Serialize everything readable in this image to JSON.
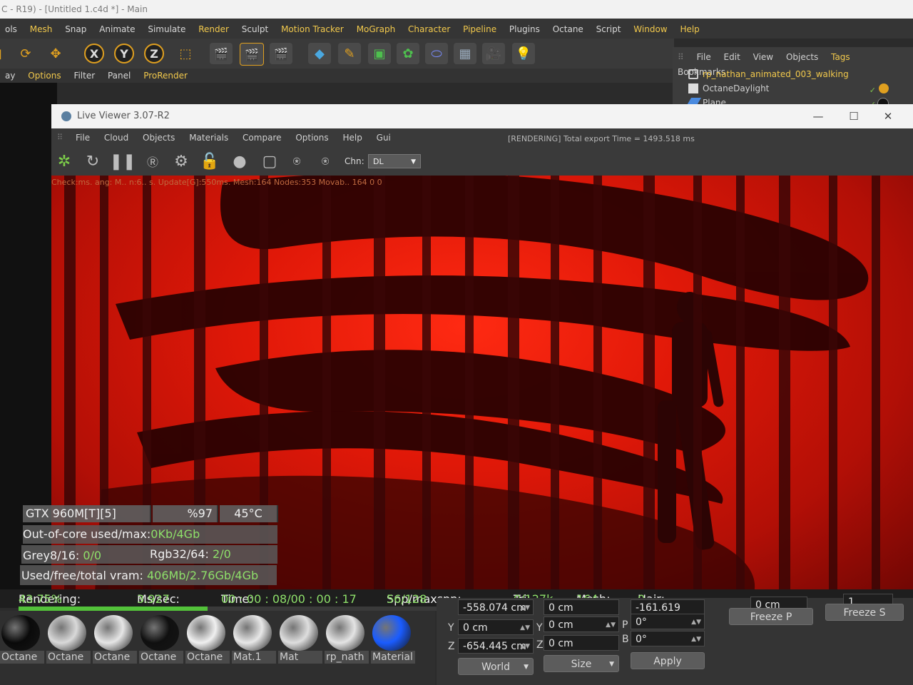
{
  "c4d": {
    "title": "C - R19) - [Untitled 1.c4d *] - Main",
    "menu": [
      {
        "label": "ols"
      },
      {
        "label": "Mesh"
      },
      {
        "label": "Snap"
      },
      {
        "label": "Animate"
      },
      {
        "label": "Simulate"
      },
      {
        "label": "Render"
      },
      {
        "label": "Sculpt"
      },
      {
        "label": "Motion Tracker"
      },
      {
        "label": "MoGraph"
      },
      {
        "label": "Character"
      },
      {
        "label": "Pipeline"
      },
      {
        "label": "Plugins"
      },
      {
        "label": "Octane"
      },
      {
        "label": "Script"
      },
      {
        "label": "Window"
      },
      {
        "label": "Help"
      }
    ],
    "axis_buttons": [
      "X",
      "Y",
      "Z"
    ],
    "viewport_menu": [
      "ay",
      "Options",
      "Filter",
      "Panel",
      "ProRender"
    ]
  },
  "object_manager": {
    "menu": [
      "File",
      "Edit",
      "View",
      "Objects",
      "Tags",
      "Bookmarks"
    ],
    "objects": [
      {
        "label": "rp_nathan_animated_003_walking",
        "color": "#f2c94c"
      },
      {
        "label": "OctaneDaylight",
        "color": "#d8d8d8"
      },
      {
        "label": "Plane",
        "color": "#d8d8d8"
      }
    ]
  },
  "live_viewer": {
    "title": "Live Viewer 3.07-R2",
    "window_buttons": {
      "minimize": "—",
      "maximize": "☐",
      "close": "✕"
    },
    "menu": [
      "File",
      "Cloud",
      "Objects",
      "Materials",
      "Compare",
      "Options",
      "Help",
      "Gui"
    ],
    "status": "[RENDERING] Total export Time = 1493.518 ms",
    "channel_label": "Chn:",
    "channel_value": "DL",
    "render_info": "Check:ms. ang: M.. n:6.. s. Update[G]:550ms. Mesh:164 Nodes:353 Movab.. 164 0 0"
  },
  "stats": {
    "gpu": "GTX 960M[T][5]",
    "gpu_load": "%97",
    "gpu_temp": "45°C",
    "out_of_core_label": "Out-of-core used/max:",
    "out_of_core_value": "0Kb/4Gb",
    "grey_label": "Grey8/16: ",
    "grey_value": "0/0",
    "rgb_label": "Rgb32/64: ",
    "rgb_value": "2/0",
    "vram_label": "Used/free/total vram: ",
    "vram_value": "406Mb/2.76Gb/4Gb"
  },
  "render_status": {
    "rendering_label": "Rendering: ",
    "rendering_value": "43.75%",
    "mssec_label": "Ms/sec: ",
    "mssec_value": "3.927",
    "time_label": "Time: ",
    "time_value": "00 : 00 : 08/00 : 00 : 17",
    "spp_label": "Spp/maxspp: ",
    "spp_value": "56/128",
    "tri_label": "Tri: ",
    "tri_value": "0/127k",
    "mesh_label": "Mesh: ",
    "mesh_value": "164",
    "hair_label": "Hair: ",
    "hair_value": "0",
    "progress": 0.4375
  },
  "materials": [
    {
      "name": "Octane",
      "color": "#0a0a0a"
    },
    {
      "name": "Octane",
      "color": "#d9d9d9"
    },
    {
      "name": "Octane",
      "color": "#e6e6e6"
    },
    {
      "name": "Octane",
      "color": "#101010"
    },
    {
      "name": "Octane",
      "color": "#f0f0f0"
    },
    {
      "name": "Mat.1",
      "color": "#e8e8e8"
    },
    {
      "name": "Mat",
      "color": "#dedede"
    },
    {
      "name": "rp_nath",
      "color": "#e4e4e4"
    },
    {
      "name": "Material",
      "color": "#1a5cff"
    }
  ],
  "coordinates": {
    "x_pos": "-558.074 cm",
    "x_size": "0 cm",
    "h_rot": "-161.619",
    "y_pos": "0 cm",
    "y_size": "0 cm",
    "p_rot": "0°",
    "z_pos": "-654.445 cm",
    "z_size": "0 cm",
    "b_rot": "0°",
    "pz_value": "0 cm",
    "sz_value": "1",
    "world_label": "World",
    "size_label": "Size",
    "apply_label": "Apply",
    "freeze_p_label": "Freeze P",
    "freeze_s_label": "Freeze S"
  }
}
